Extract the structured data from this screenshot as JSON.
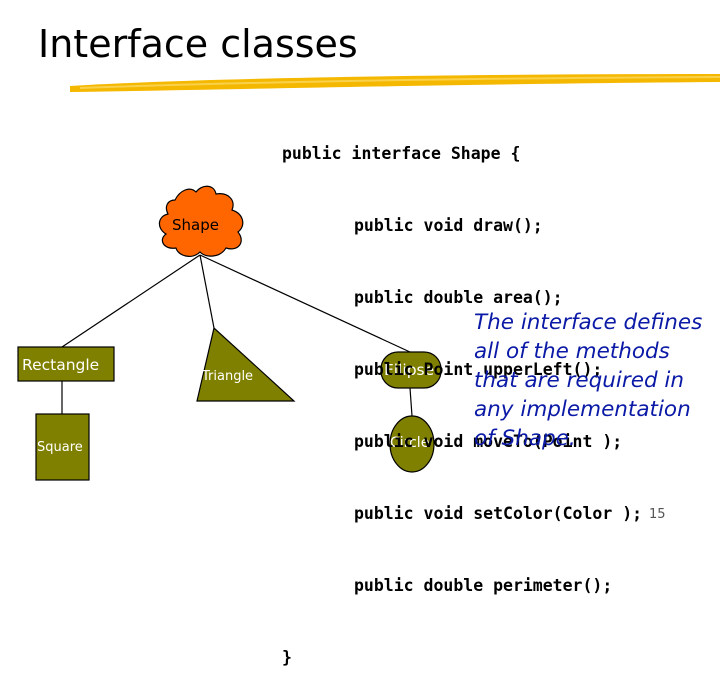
{
  "slide": {
    "title": "Interface classes",
    "page_number": "15"
  },
  "code": {
    "lines": [
      "public interface Shape {",
      "public void draw();",
      "public double area();",
      "public Point upperLeft();",
      "public void moveTo(Point );",
      "public void setColor(Color );",
      "public double perimeter();",
      "}"
    ]
  },
  "diagram": {
    "root": "Shape",
    "nodes": {
      "rectangle": "Rectangle",
      "triangle": "Triangle",
      "ellipse": "Ellipse",
      "square": "Square",
      "circle": "Circle"
    }
  },
  "note": "The interface defines all of the methods that are required in any implementation of Shape.",
  "colors": {
    "root_fill": "#ff6600",
    "node_fill": "#808000",
    "note_text": "#0b1aa6",
    "title_bar": "#f5b800"
  }
}
